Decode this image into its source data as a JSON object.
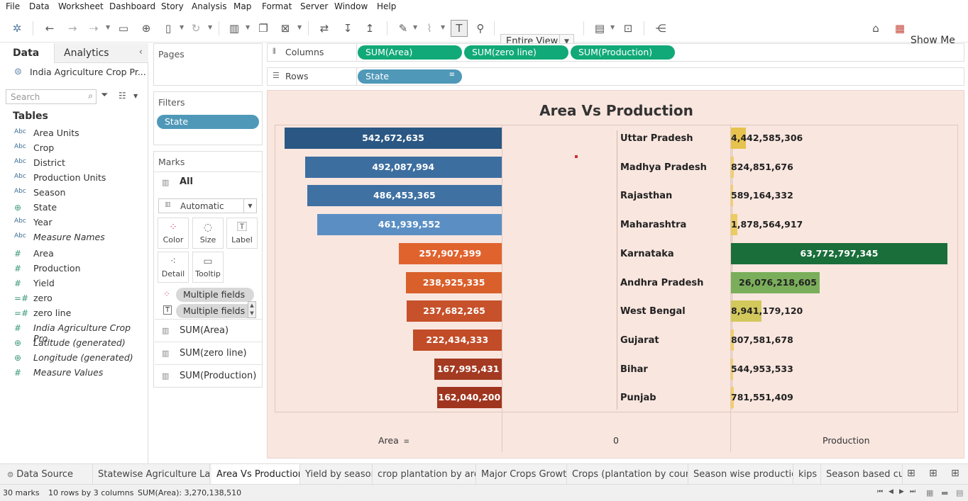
{
  "menu": [
    "File",
    "Data",
    "Worksheet",
    "Dashboard",
    "Story",
    "Analysis",
    "Map",
    "Format",
    "Server",
    "Window",
    "Help"
  ],
  "toolbar": {
    "view_select": "Entire View",
    "show_me": "Show Me"
  },
  "sidebar": {
    "tab_data": "Data",
    "tab_analytics": "Analytics",
    "datasource": "India Agriculture Crop Pr...",
    "search_placeholder": "Search",
    "tables_heading": "Tables",
    "fields": [
      {
        "type": "Abc",
        "name": "Area Units"
      },
      {
        "type": "Abc",
        "name": "Crop"
      },
      {
        "type": "Abc",
        "name": "District"
      },
      {
        "type": "Abc",
        "name": "Production Units"
      },
      {
        "type": "Abc",
        "name": "Season"
      },
      {
        "type": "geo",
        "name": "State"
      },
      {
        "type": "Abc",
        "name": "Year"
      },
      {
        "type": "Abc",
        "name": "Measure Names"
      },
      {
        "type": "#",
        "name": "Area"
      },
      {
        "type": "#",
        "name": "Production"
      },
      {
        "type": "#",
        "name": "Yield"
      },
      {
        "type": "=#",
        "name": "zero"
      },
      {
        "type": "=#",
        "name": "zero line"
      },
      {
        "type": "#",
        "name": "India Agriculture Crop Pro..."
      },
      {
        "type": "geo",
        "name": "Latitude (generated)"
      },
      {
        "type": "geo",
        "name": "Longitude (generated)"
      },
      {
        "type": "#",
        "name": "Measure Values"
      }
    ]
  },
  "pages": {
    "title": "Pages"
  },
  "filters": {
    "title": "Filters",
    "pill": "State"
  },
  "marks": {
    "title": "Marks",
    "all": "All",
    "mark_type": "Automatic",
    "cards": [
      "Color",
      "Size",
      "Label",
      "Detail",
      "Tooltip"
    ],
    "fields": [
      "Multiple fields",
      "Multiple fields"
    ],
    "measures": [
      "SUM(Area)",
      "SUM(zero line)",
      "SUM(Production)"
    ]
  },
  "shelves": {
    "columns_label": "Columns",
    "columns": [
      "SUM(Area)",
      "SUM(zero line)",
      "SUM(Production)"
    ],
    "rows_label": "Rows",
    "rows": [
      "State"
    ]
  },
  "chart_data": {
    "type": "bar",
    "title": "Area Vs Production",
    "categories": [
      "Uttar Pradesh",
      "Madhya Pradesh",
      "Rajasthan",
      "Maharashtra",
      "Karnataka",
      "Andhra Pradesh",
      "West Bengal",
      "Gujarat",
      "Bihar",
      "Punjab"
    ],
    "series": [
      {
        "name": "Area",
        "values": [
          542672635,
          492087994,
          486453365,
          461939552,
          257907399,
          238925335,
          237682265,
          222434333,
          167995431,
          162040200
        ],
        "labels": [
          "542,672,635",
          "492,087,994",
          "486,453,365",
          "461,939,552",
          "257,907,399",
          "238,925,335",
          "237,682,265",
          "222,434,333",
          "167,995,431",
          "162,040,200"
        ],
        "colors": [
          "#2a5783",
          "#3d6ea0",
          "#3f71a3",
          "#5b8fc4",
          "#e0632e",
          "#d9602b",
          "#c7512a",
          "#c24c28",
          "#a43a22",
          "#a0351f"
        ]
      },
      {
        "name": "Production",
        "values": [
          4442585306,
          824851676,
          589164332,
          1878564917,
          63772797345,
          26076218605,
          8941179120,
          807581678,
          544953533,
          781551409
        ],
        "labels": [
          "4,442,585,306",
          "824,851,676",
          "589,164,332",
          "1,878,564,917",
          "63,772,797,345",
          "26,076,218,605",
          "8,941,179,120",
          "807,581,678",
          "544,953,533",
          "781,551,409"
        ],
        "colors": [
          "#e6c24e",
          "#f2cf6b",
          "#f2cf6b",
          "#eccb62",
          "#1a6e3a",
          "#7aae5a",
          "#d3c85c",
          "#f2cf6b",
          "#f2cf6b",
          "#f2cf6b"
        ]
      }
    ],
    "axis_labels": [
      "Area",
      "0",
      "Production"
    ]
  },
  "sheet_tabs": [
    "Data Source",
    "Statewise Agriculture Land",
    "Area Vs Production",
    "Yield by season",
    "crop plantation by area",
    "Major Crops Growth",
    "Crops (plantation by count)",
    "Season wise production",
    "kips",
    "Season based cultiv"
  ],
  "status": {
    "marks": "30 marks",
    "rows_cols": "10 rows by 3 columns",
    "sum": "SUM(Area): 3,270,138,510"
  }
}
